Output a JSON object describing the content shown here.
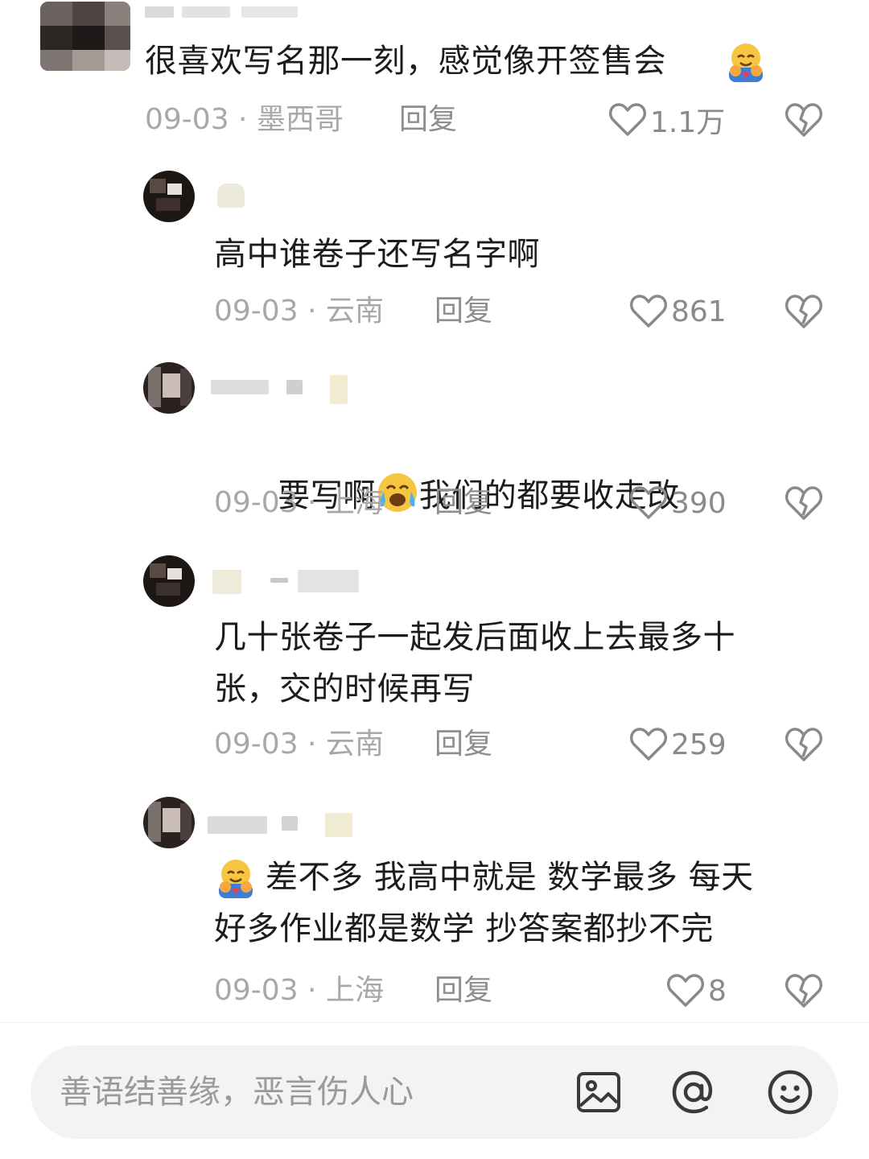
{
  "comments": [
    {
      "text": "很喜欢写名那一刻，感觉像开签售会",
      "date": "09-03",
      "location": "墨西哥",
      "reply_label": "回复",
      "likes": "1.1万"
    },
    {
      "text": "高中谁卷子还写名字啊",
      "date": "09-03",
      "location": "云南",
      "reply_label": "回复",
      "likes": "861"
    },
    {
      "text_before": "要写啊",
      "text_after": "我们的都要收走改",
      "date": "09-03",
      "location": "上海",
      "reply_label": "回复",
      "likes": "390"
    },
    {
      "text": "几十张卷子一起发后面收上去最多十\n张，交的时候再写",
      "date": "09-03",
      "location": "云南",
      "reply_label": "回复",
      "likes": "259"
    },
    {
      "text": "差不多 我高中就是 数学最多 每天\n好多作业都是数学 抄答案都抄不完",
      "date": "09-03",
      "location": "上海",
      "reply_label": "回复",
      "likes": "8"
    }
  ],
  "meta_separator": " · ",
  "input": {
    "placeholder": "善语结善缘，恶言伤人心"
  },
  "icons": {
    "like": "heart-outline-icon",
    "dislike": "broken-heart-icon",
    "image": "image-icon",
    "mention": "at-icon",
    "emoji": "smiley-icon"
  },
  "colors": {
    "text": "#1c1c1c",
    "meta": "#a8a8a8",
    "icon": "#8a8a8a",
    "input_bg": "#f3f3f3"
  }
}
